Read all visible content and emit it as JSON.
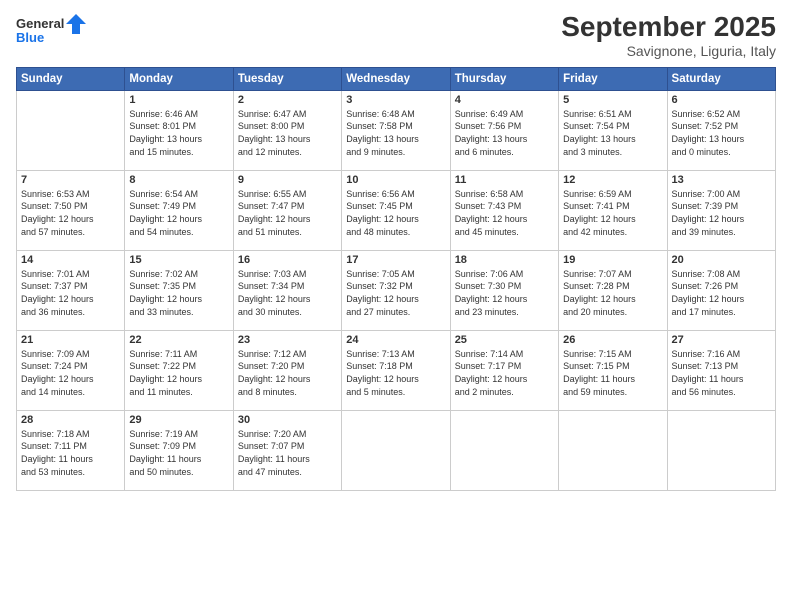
{
  "logo": {
    "line1": "General",
    "line2": "Blue"
  },
  "header": {
    "title": "September 2025",
    "location": "Savignone, Liguria, Italy"
  },
  "weekdays": [
    "Sunday",
    "Monday",
    "Tuesday",
    "Wednesday",
    "Thursday",
    "Friday",
    "Saturday"
  ],
  "weeks": [
    [
      {
        "day": "",
        "info": ""
      },
      {
        "day": "1",
        "info": "Sunrise: 6:46 AM\nSunset: 8:01 PM\nDaylight: 13 hours\nand 15 minutes."
      },
      {
        "day": "2",
        "info": "Sunrise: 6:47 AM\nSunset: 8:00 PM\nDaylight: 13 hours\nand 12 minutes."
      },
      {
        "day": "3",
        "info": "Sunrise: 6:48 AM\nSunset: 7:58 PM\nDaylight: 13 hours\nand 9 minutes."
      },
      {
        "day": "4",
        "info": "Sunrise: 6:49 AM\nSunset: 7:56 PM\nDaylight: 13 hours\nand 6 minutes."
      },
      {
        "day": "5",
        "info": "Sunrise: 6:51 AM\nSunset: 7:54 PM\nDaylight: 13 hours\nand 3 minutes."
      },
      {
        "day": "6",
        "info": "Sunrise: 6:52 AM\nSunset: 7:52 PM\nDaylight: 13 hours\nand 0 minutes."
      }
    ],
    [
      {
        "day": "7",
        "info": "Sunrise: 6:53 AM\nSunset: 7:50 PM\nDaylight: 12 hours\nand 57 minutes."
      },
      {
        "day": "8",
        "info": "Sunrise: 6:54 AM\nSunset: 7:49 PM\nDaylight: 12 hours\nand 54 minutes."
      },
      {
        "day": "9",
        "info": "Sunrise: 6:55 AM\nSunset: 7:47 PM\nDaylight: 12 hours\nand 51 minutes."
      },
      {
        "day": "10",
        "info": "Sunrise: 6:56 AM\nSunset: 7:45 PM\nDaylight: 12 hours\nand 48 minutes."
      },
      {
        "day": "11",
        "info": "Sunrise: 6:58 AM\nSunset: 7:43 PM\nDaylight: 12 hours\nand 45 minutes."
      },
      {
        "day": "12",
        "info": "Sunrise: 6:59 AM\nSunset: 7:41 PM\nDaylight: 12 hours\nand 42 minutes."
      },
      {
        "day": "13",
        "info": "Sunrise: 7:00 AM\nSunset: 7:39 PM\nDaylight: 12 hours\nand 39 minutes."
      }
    ],
    [
      {
        "day": "14",
        "info": "Sunrise: 7:01 AM\nSunset: 7:37 PM\nDaylight: 12 hours\nand 36 minutes."
      },
      {
        "day": "15",
        "info": "Sunrise: 7:02 AM\nSunset: 7:35 PM\nDaylight: 12 hours\nand 33 minutes."
      },
      {
        "day": "16",
        "info": "Sunrise: 7:03 AM\nSunset: 7:34 PM\nDaylight: 12 hours\nand 30 minutes."
      },
      {
        "day": "17",
        "info": "Sunrise: 7:05 AM\nSunset: 7:32 PM\nDaylight: 12 hours\nand 27 minutes."
      },
      {
        "day": "18",
        "info": "Sunrise: 7:06 AM\nSunset: 7:30 PM\nDaylight: 12 hours\nand 23 minutes."
      },
      {
        "day": "19",
        "info": "Sunrise: 7:07 AM\nSunset: 7:28 PM\nDaylight: 12 hours\nand 20 minutes."
      },
      {
        "day": "20",
        "info": "Sunrise: 7:08 AM\nSunset: 7:26 PM\nDaylight: 12 hours\nand 17 minutes."
      }
    ],
    [
      {
        "day": "21",
        "info": "Sunrise: 7:09 AM\nSunset: 7:24 PM\nDaylight: 12 hours\nand 14 minutes."
      },
      {
        "day": "22",
        "info": "Sunrise: 7:11 AM\nSunset: 7:22 PM\nDaylight: 12 hours\nand 11 minutes."
      },
      {
        "day": "23",
        "info": "Sunrise: 7:12 AM\nSunset: 7:20 PM\nDaylight: 12 hours\nand 8 minutes."
      },
      {
        "day": "24",
        "info": "Sunrise: 7:13 AM\nSunset: 7:18 PM\nDaylight: 12 hours\nand 5 minutes."
      },
      {
        "day": "25",
        "info": "Sunrise: 7:14 AM\nSunset: 7:17 PM\nDaylight: 12 hours\nand 2 minutes."
      },
      {
        "day": "26",
        "info": "Sunrise: 7:15 AM\nSunset: 7:15 PM\nDaylight: 11 hours\nand 59 minutes."
      },
      {
        "day": "27",
        "info": "Sunrise: 7:16 AM\nSunset: 7:13 PM\nDaylight: 11 hours\nand 56 minutes."
      }
    ],
    [
      {
        "day": "28",
        "info": "Sunrise: 7:18 AM\nSunset: 7:11 PM\nDaylight: 11 hours\nand 53 minutes."
      },
      {
        "day": "29",
        "info": "Sunrise: 7:19 AM\nSunset: 7:09 PM\nDaylight: 11 hours\nand 50 minutes."
      },
      {
        "day": "30",
        "info": "Sunrise: 7:20 AM\nSunset: 7:07 PM\nDaylight: 11 hours\nand 47 minutes."
      },
      {
        "day": "",
        "info": ""
      },
      {
        "day": "",
        "info": ""
      },
      {
        "day": "",
        "info": ""
      },
      {
        "day": "",
        "info": ""
      }
    ]
  ]
}
